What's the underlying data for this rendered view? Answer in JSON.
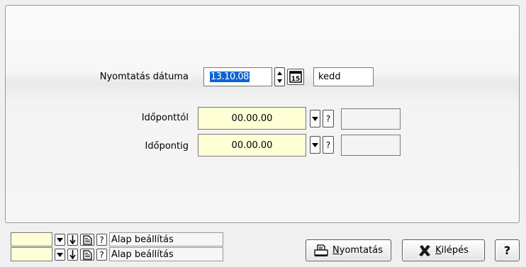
{
  "form": {
    "print_date_label": "Nyomtatás dátuma",
    "print_date_value": "13.10.08",
    "weekday": "kedd",
    "time_from_label": "Időponttól",
    "time_from_value": "00.00.00",
    "time_to_label": "Időpontig",
    "time_to_value": "00.00.00",
    "help_glyph": "?"
  },
  "settings_rows": [
    {
      "label": "Alap beállítás"
    },
    {
      "label": "Alap beállítás"
    }
  ],
  "buttons": {
    "print_label": "Nyomtatás",
    "exit_label": "Kilépés",
    "help_label": "?"
  },
  "colors": {
    "input_highlight": "#ffffd6",
    "selection": "#0a64d6",
    "exit_icon": "#1a1a1a"
  },
  "icons": [
    "spin-up-down-icon",
    "calendar-icon",
    "dropdown-arrow-icon",
    "help-icon",
    "down-arrow-icon",
    "document-icon",
    "printer-icon",
    "x-close-icon"
  ]
}
